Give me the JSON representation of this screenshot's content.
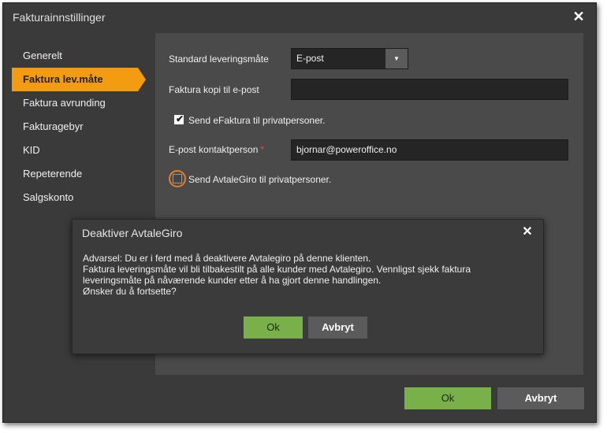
{
  "window": {
    "title": "Fakturainnstillinger",
    "close_icon": "close-icon",
    "close_glyph": "✕"
  },
  "sidebar": {
    "items": [
      {
        "label": "Generelt"
      },
      {
        "label": "Faktura lev.måte",
        "active": true
      },
      {
        "label": "Faktura avrunding"
      },
      {
        "label": "Fakturagebyr"
      },
      {
        "label": "KID"
      },
      {
        "label": "Repeterende"
      },
      {
        "label": "Salgskonto"
      }
    ],
    "active_color": "#f39c12"
  },
  "form": {
    "delivery_method_label": "Standard leveringsmåte",
    "delivery_method_value": "E-post",
    "dropdown_glyph": "▼",
    "invoice_copy_label": "Faktura kopi til e-post",
    "invoice_copy_value": "",
    "efaktura_checkbox_label": "Send eFaktura til privatpersoner.",
    "efaktura_checked": true,
    "check_glyph": "✔",
    "contact_email_label": "E-post kontaktperson",
    "required_mark": "*",
    "contact_email_value": "bjornar@poweroffice.no",
    "avtalegiro_checkbox_label": "Send AvtaleGiro til privatpersoner.",
    "avtalegiro_checked": false
  },
  "modal": {
    "title": "Deaktiver AvtaleGiro",
    "close_glyph": "✕",
    "message_lines": [
      "Advarsel: Du er i ferd med å deaktivere Avtalegiro på denne klienten.",
      "Faktura leveringsmåte vil bli tilbakestilt på alle kunder med Avtalegiro. Vennligst sjekk faktura",
      "leveringsmåte på nåværende kunder etter å ha gjort denne handlingen.",
      "Ønsker du å fortsette?"
    ],
    "ok_label": "Ok",
    "cancel_label": "Avbryt"
  },
  "footer": {
    "ok_label": "Ok",
    "cancel_label": "Avbryt"
  },
  "colors": {
    "accent": "#f39c12",
    "ok_button": "#7ab04a",
    "focus_ring": "#e67e22",
    "required": "#e74c3c"
  }
}
